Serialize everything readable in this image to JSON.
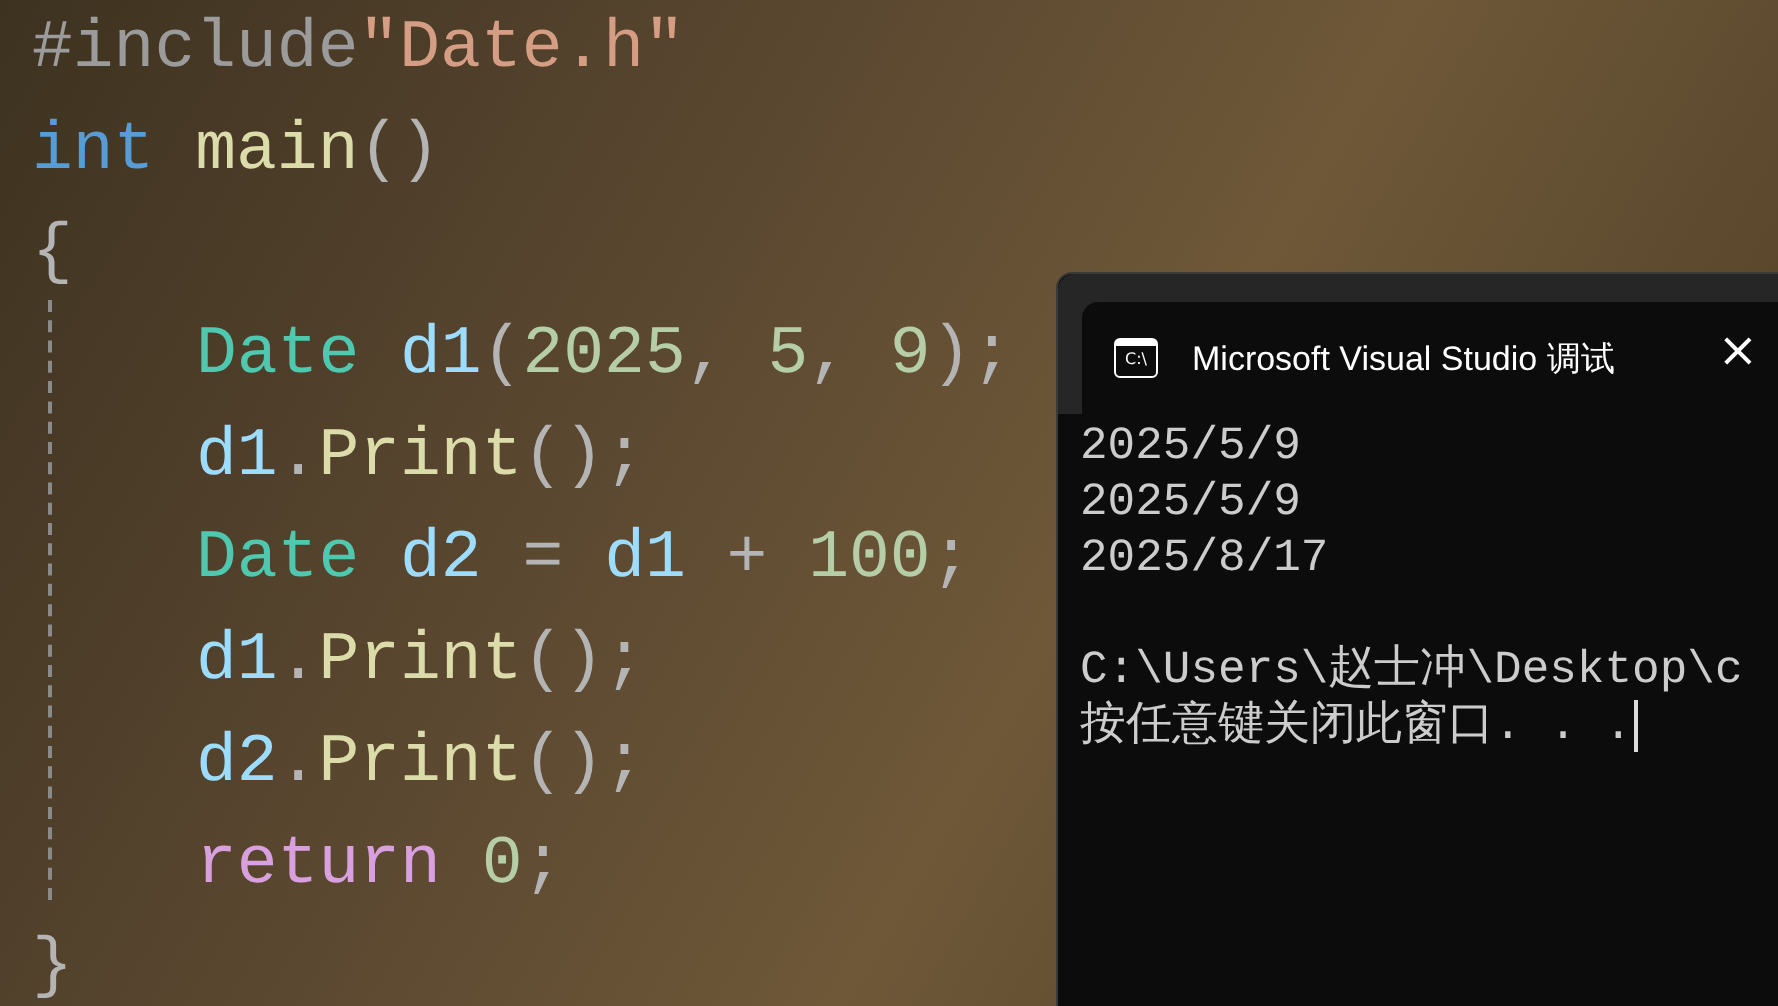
{
  "editor": {
    "head": [
      {
        "tokens": [
          {
            "text": "#include",
            "kind": "directive"
          },
          {
            "text": "\"Date.h\"",
            "kind": "string"
          }
        ]
      },
      {
        "tokens": [
          {
            "text": "int",
            "kind": "keyword"
          },
          {
            "text": " main",
            "kind": "function"
          },
          {
            "text": "()",
            "kind": "punct"
          }
        ]
      },
      {
        "tokens": [
          {
            "text": "{",
            "kind": "punct"
          }
        ]
      }
    ],
    "body": [
      {
        "tokens": [
          {
            "text": "Date",
            "kind": "type"
          },
          {
            "text": " d1",
            "kind": "variable"
          },
          {
            "text": "(",
            "kind": "punct"
          },
          {
            "text": "2025",
            "kind": "number"
          },
          {
            "text": ", ",
            "kind": "punct"
          },
          {
            "text": "5",
            "kind": "number"
          },
          {
            "text": ", ",
            "kind": "punct"
          },
          {
            "text": "9",
            "kind": "number"
          },
          {
            "text": ");",
            "kind": "punct"
          }
        ]
      },
      {
        "tokens": [
          {
            "text": "d1",
            "kind": "variable"
          },
          {
            "text": ".",
            "kind": "punct"
          },
          {
            "text": "Print",
            "kind": "function"
          },
          {
            "text": "();",
            "kind": "punct"
          }
        ]
      },
      {
        "tokens": [
          {
            "text": "Date",
            "kind": "type"
          },
          {
            "text": " d2",
            "kind": "variable"
          },
          {
            "text": " = ",
            "kind": "punct"
          },
          {
            "text": "d1",
            "kind": "variable"
          },
          {
            "text": " + ",
            "kind": "punct"
          },
          {
            "text": "100",
            "kind": "number"
          },
          {
            "text": ";",
            "kind": "punct"
          }
        ]
      },
      {
        "tokens": [
          {
            "text": "d1",
            "kind": "variable"
          },
          {
            "text": ".",
            "kind": "punct"
          },
          {
            "text": "Print",
            "kind": "function"
          },
          {
            "text": "();",
            "kind": "punct"
          }
        ]
      },
      {
        "tokens": [
          {
            "text": "d2",
            "kind": "variable"
          },
          {
            "text": ".",
            "kind": "punct"
          },
          {
            "text": "Print",
            "kind": "function"
          },
          {
            "text": "();",
            "kind": "punct"
          }
        ]
      },
      {
        "tokens": [
          {
            "text": "return",
            "kind": "control"
          },
          {
            "text": " 0",
            "kind": "number"
          },
          {
            "text": ";",
            "kind": "punct"
          }
        ]
      }
    ],
    "tail": [
      {
        "tokens": [
          {
            "text": "}",
            "kind": "punct"
          }
        ]
      }
    ]
  },
  "console": {
    "icon_label": "C:\\",
    "title": "Microsoft Visual Studio 调试",
    "close": "×",
    "output": [
      "2025/5/9",
      "2025/5/9",
      "2025/8/17"
    ],
    "path": "C:\\Users\\赵士冲\\Desktop\\c",
    "prompt": "按任意键关闭此窗口. . ."
  }
}
